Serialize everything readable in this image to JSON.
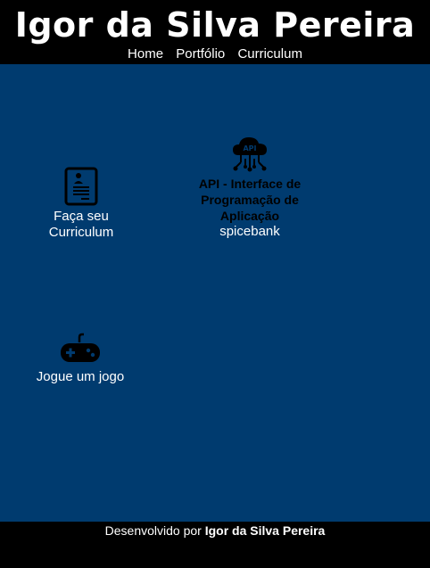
{
  "header": {
    "title": "Igor da Silva Pereira",
    "nav": [
      "Home",
      "Portfólio",
      "Curriculum"
    ]
  },
  "cards": {
    "curriculum": {
      "label": "Faça seu Curriculum",
      "icon": "resume-icon"
    },
    "api": {
      "label": "API - Interface de Programação de Aplicação",
      "sub": "spicebank",
      "icon": "api-cloud-icon",
      "icon_text": "API"
    },
    "game": {
      "label": "Jogue um jogo",
      "icon": "gamepad-icon"
    }
  },
  "footer": {
    "prefix": "Desenvolvido por ",
    "author": "Igor da Silva Pereira"
  },
  "colors": {
    "header_bg": "#000000",
    "main_bg": "#003b6f",
    "footer_bg": "#000000",
    "text": "#ffffff"
  }
}
